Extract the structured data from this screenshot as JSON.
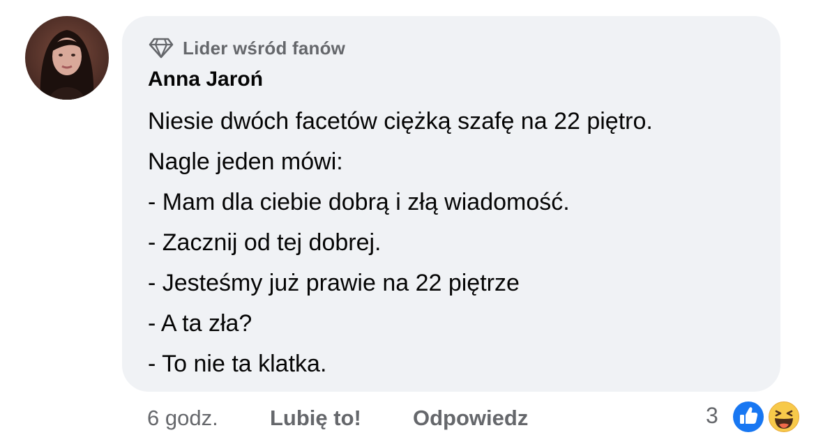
{
  "comment": {
    "badge_label": "Lider wśród fanów",
    "badge_icon": "diamond-icon",
    "author": "Anna Jaroń",
    "lines": [
      "Niesie dwóch facetów ciężką szafę na 22 piętro.",
      "Nagle jeden mówi:",
      "- Mam dla ciebie dobrą i złą wiadomość.",
      "- Zacznij od tej dobrej.",
      "- Jesteśmy już prawie na 22 piętrze",
      "- A ta zła?",
      "- To nie ta klatka."
    ],
    "bubble_color": "#f0f2f5"
  },
  "footer": {
    "time": "6 godz.",
    "like_label": "Lubię to!",
    "reply_label": "Odpowiedz",
    "reaction_count": "3",
    "reactions": [
      "like-icon",
      "haha-icon"
    ],
    "secondary_text_color": "#65676b",
    "like_color": "#1877f2"
  }
}
